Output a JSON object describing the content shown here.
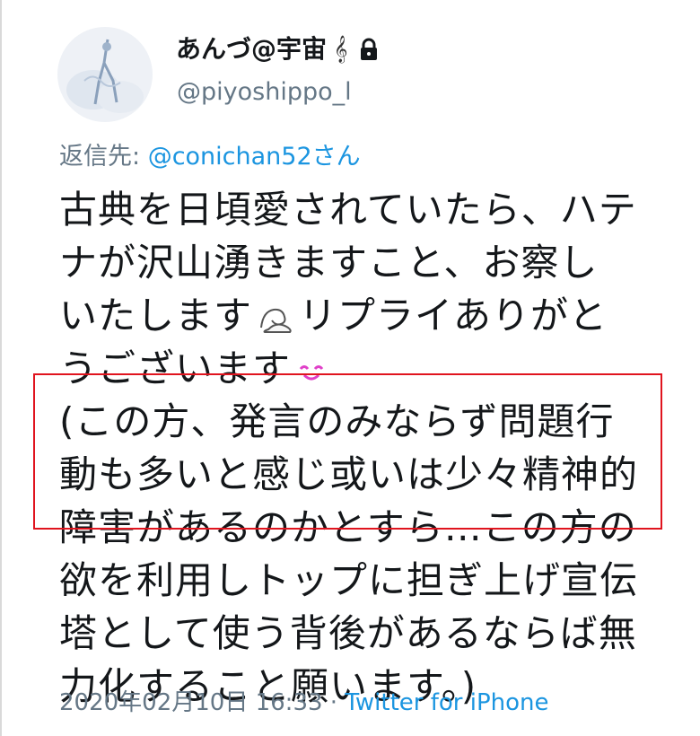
{
  "tweet": {
    "display_name": "あんづ@宇宙",
    "clef_icon": "treble-clef-icon",
    "lock_icon": "lock-icon",
    "handle": "@piyoshippo_l",
    "reply_label": "返信先: ",
    "reply_mention": "@conichan52さん",
    "body_lines": [
      "古典を日頃愛されていたら、ハテ",
      "ナが沢山湧きますこと、お察し",
      "いたします",
      "リプライありがと",
      "うございます",
      "(この方、発言のみならず問題行",
      "動も多いと感じ或いは少々精神的",
      "障害があるのかとすら…この方の",
      "欲を利用しトップに担ぎ上げ宣伝",
      "塔として使う背後があるならば無",
      "力化すること願います。)"
    ],
    "timestamp": "2020年02月10日 16:33",
    "separator": " · ",
    "client": "Twitter for iPhone"
  },
  "colors": {
    "link": "#1b95e0",
    "secondary_text": "#657786",
    "highlight_border": "#e0141e",
    "emoji_smile": "#e040c8"
  }
}
